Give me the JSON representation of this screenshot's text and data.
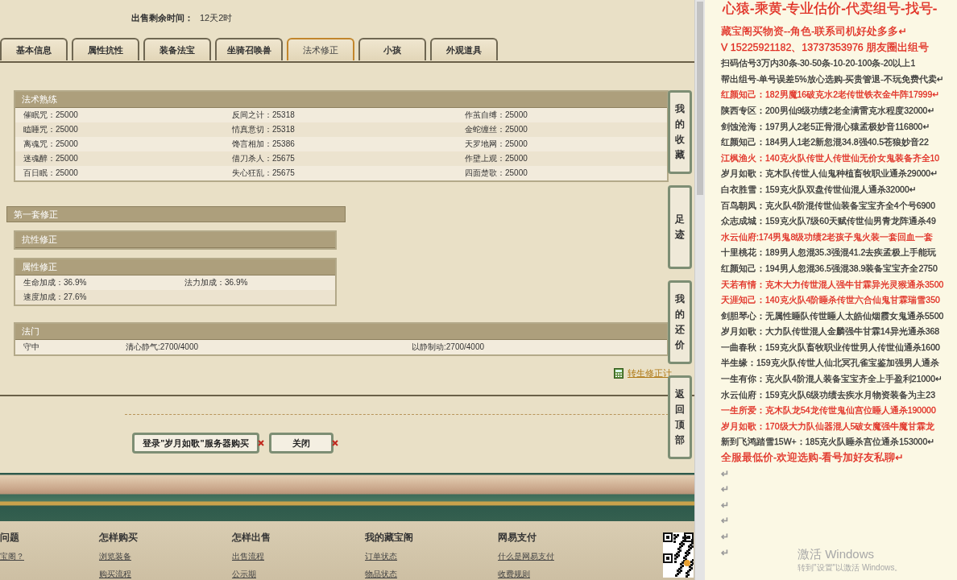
{
  "sale": {
    "label": "出售剩余时间：",
    "value": "12天2时"
  },
  "tabs": [
    {
      "label": "基本信息",
      "selected": false
    },
    {
      "label": "属性抗性",
      "selected": false
    },
    {
      "label": "装备法宝",
      "selected": false
    },
    {
      "label": "坐骑召唤兽",
      "selected": false
    },
    {
      "label": "法术修正",
      "selected": true
    },
    {
      "label": "小孩",
      "selected": false
    },
    {
      "label": "外观道具",
      "selected": false
    }
  ],
  "skills": {
    "title": "法术熟练",
    "rows": [
      [
        "催眠咒：25000",
        "反间之计：25318",
        "作茧自缚：25000"
      ],
      [
        "瞌睡咒：25000",
        "情真意切：25318",
        "金蛇缠丝：25000"
      ],
      [
        "离魂咒：25000",
        "馋言相加：25386",
        "天罗地网：25000"
      ],
      [
        "迷魂醉：25000",
        "借刀杀人：25675",
        "作壁上观：25000"
      ],
      [
        "百日眠：25000",
        "失心狂乱：25675",
        "四面楚歌：25000"
      ]
    ]
  },
  "correction": {
    "title": "第一套修正",
    "resist": {
      "title": "抗性修正"
    },
    "attr": {
      "title": "属性修正",
      "items": [
        "生命加成：36.9%",
        "法力加成：36.9%",
        "速度加成：27.6%"
      ]
    }
  },
  "famen": {
    "title": "法门",
    "cells": [
      "守中",
      "清心静气:2700/4000",
      "以静制动:2700/4000"
    ]
  },
  "calc_link": "转生修正计",
  "side_buttons": [
    "我的收藏",
    "足迹",
    "我的还价",
    "返回顶部"
  ],
  "actions": [
    "登录\"岁月如歌\"服务器购买",
    "关闭"
  ],
  "footer": [
    {
      "heading": "问题",
      "links": [
        "宝阁？"
      ]
    },
    {
      "heading": "怎样购买",
      "links": [
        "浏览装备",
        "购买流程"
      ]
    },
    {
      "heading": "怎样出售",
      "links": [
        "出售流程",
        "公示期"
      ]
    },
    {
      "heading": "我的藏宝阁",
      "links": [
        "订单状态",
        "物品状态"
      ]
    },
    {
      "heading": "网易支付",
      "links": [
        "什么是网易支付",
        "收费规则"
      ]
    }
  ],
  "doc": {
    "lines": [
      {
        "text": "心猿-乘黄-专业估价-代卖组号-找号-",
        "color": "#e02b20",
        "kind": "big"
      },
      {
        "text": "藏宝阁买物资--角色-联系司机好处多多↵",
        "color": "#e02b20",
        "kind": "mid"
      },
      {
        "text": "V 15225921182、13737353976 朋友圈出组号",
        "color": "#e02b20",
        "kind": "mid"
      },
      {
        "text": "扫码估号3万内30条-30-50条-10-20-100条-20以上1",
        "color": "#333333",
        "kind": "normal"
      },
      {
        "text": "帮出组号-单号误差5%放心选购-买贵管退-不玩免费代卖↵",
        "color": "#333333",
        "kind": "normal"
      },
      {
        "text": "红颜知己：182男魔16破克水2老传世铁衣金牛阵17999↵",
        "color": "#e02b20",
        "kind": "normal"
      },
      {
        "text": "陕西专区：200男仙9级功绩2老全满雷克水程度32000↵",
        "color": "#333333",
        "kind": "normal"
      },
      {
        "text": "剑蚀沧海：197男人2老5正骨混心猿孟极妙音116800↵",
        "color": "#333333",
        "kind": "normal"
      },
      {
        "text": "红颜知己：184男人1老2新忽混34.8强40.5苍狼妙音22",
        "color": "#333333",
        "kind": "normal"
      },
      {
        "text": "江枫渔火：140克火队传世人传世仙无价女鬼装备齐全10",
        "color": "#e02b20",
        "kind": "normal"
      },
      {
        "text": "岁月如歌：克木队传世人仙鬼种植畜牧职业通杀29000↵",
        "color": "#333333",
        "kind": "normal"
      },
      {
        "text": "白衣胜雪：159克火队双盘传世仙混人通杀32000↵",
        "color": "#333333",
        "kind": "normal"
      },
      {
        "text": "百鸟朝凤：克火队4阶混传世仙装备宝宝齐全4个号6900",
        "color": "#333333",
        "kind": "normal"
      },
      {
        "text": "众志成城：159克火队7级60天赋传世仙男青龙阵通杀49",
        "color": "#333333",
        "kind": "normal"
      },
      {
        "text": "水云仙府:174男鬼8级功绩2老孩子鬼火装一套回血一套",
        "color": "#e02b20",
        "kind": "normal"
      },
      {
        "text": "十里桃花：189男人忽混35.3强混41.2去疾孟极上手能玩",
        "color": "#333333",
        "kind": "normal"
      },
      {
        "text": "红颜知己：194男人忽混36.5强混38.9装备宝宝齐全2750",
        "color": "#333333",
        "kind": "normal"
      },
      {
        "text": "天若有情：克木大力传世混人强牛甘霖异光灵猴通杀3500",
        "color": "#e02b20",
        "kind": "normal"
      },
      {
        "text": "天涯知己：140克火队4阶睡杀传世六合仙鬼甘霖瑞雪350",
        "color": "#e02b20",
        "kind": "normal"
      },
      {
        "text": "剑胆琴心：无属性睡队传世睡人太皓仙烟霞女鬼通杀5500",
        "color": "#333333",
        "kind": "normal"
      },
      {
        "text": "岁月如歌：大力队传世混人金麟强牛甘霖14异光通杀368",
        "color": "#333333",
        "kind": "normal"
      },
      {
        "text": "一曲春秋：159克火队畜牧职业传世男人传世仙通杀1600",
        "color": "#333333",
        "kind": "normal"
      },
      {
        "text": "半生缘：159克火队传世人仙北冥孔雀宝鉴加强男人通杀",
        "color": "#333333",
        "kind": "normal"
      },
      {
        "text": "一生有你：克火队4阶混人装备宝宝齐全上手盈利21000↵",
        "color": "#333333",
        "kind": "normal"
      },
      {
        "text": "水云仙府：159克火队6级功绩去疾水月物资装备为主23",
        "color": "#333333",
        "kind": "normal"
      },
      {
        "text": "一生所爱：克木队龙54龙传世鬼仙宫位睡人通杀190000",
        "color": "#e02b20",
        "kind": "normal"
      },
      {
        "text": "岁月如歌：170级大力队仙器混人5破女魔强牛魔甘霖龙",
        "color": "#e02b20",
        "kind": "normal"
      },
      {
        "text": "新到飞鸿踏雪15W+：185克火队睡杀宫位通杀153000↵",
        "color": "#333333",
        "kind": "normal"
      },
      {
        "text": "全服最低价-欢迎选购-看号加好友私聊↵",
        "color": "#e02b20",
        "kind": "mid"
      },
      {
        "text": "↵",
        "color": "#999999",
        "kind": "mark"
      },
      {
        "text": "↵",
        "color": "#999999",
        "kind": "mark"
      },
      {
        "text": "↵",
        "color": "#999999",
        "kind": "mark"
      },
      {
        "text": "↵",
        "color": "#999999",
        "kind": "mark"
      },
      {
        "text": "↵",
        "color": "#999999",
        "kind": "mark"
      },
      {
        "text": "↵",
        "color": "#999999",
        "kind": "mark"
      }
    ]
  },
  "os_notice": {
    "title": "激活 Windows",
    "subtitle": "转到\"设置\"以激活 Windows。"
  }
}
